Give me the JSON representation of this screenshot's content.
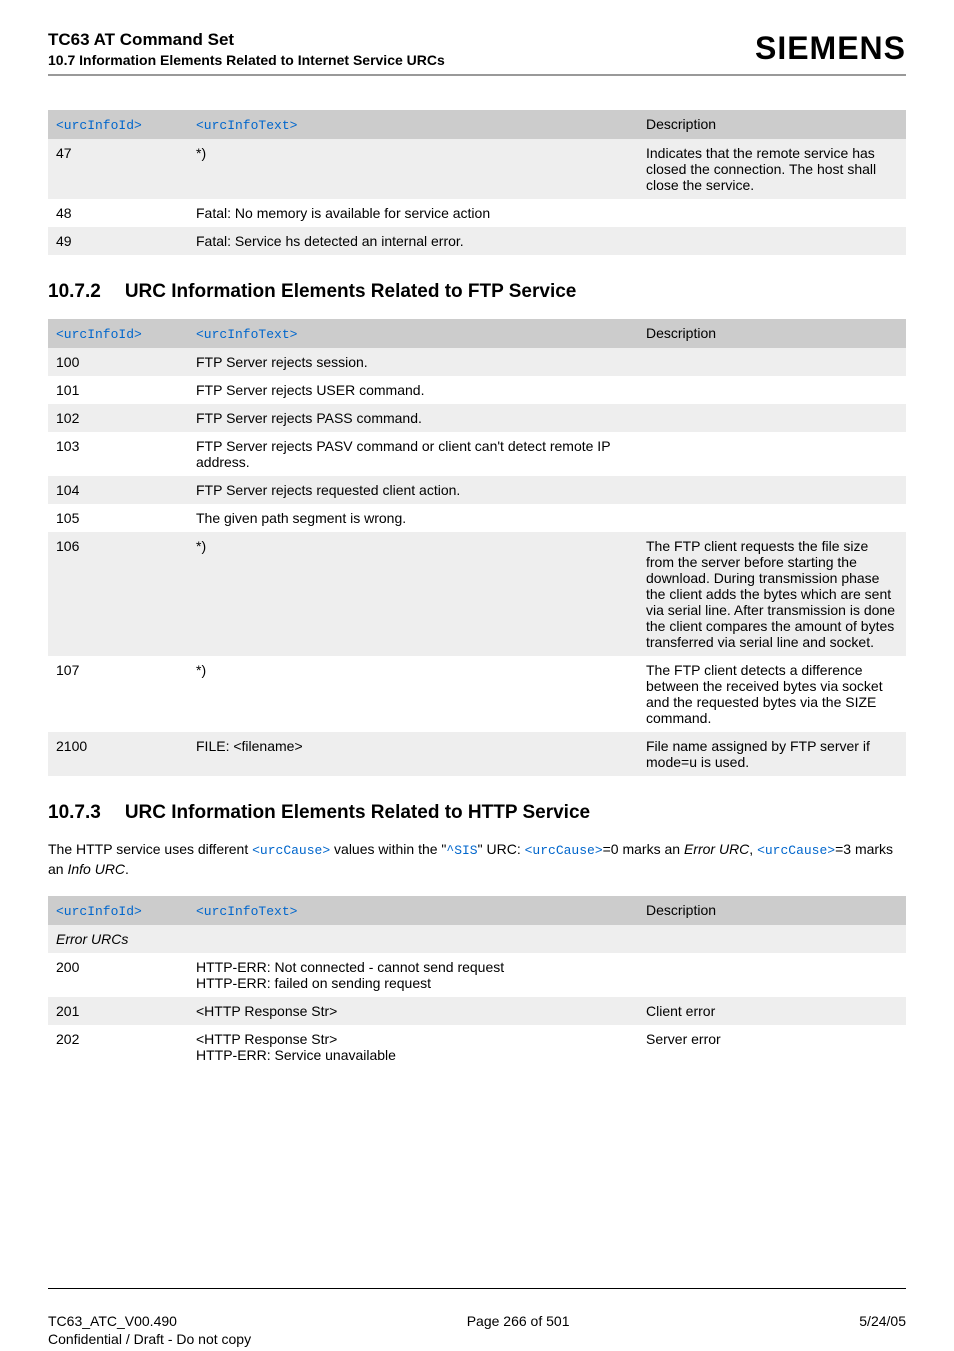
{
  "header": {
    "title": "TC63 AT Command Set",
    "subtitle": "10.7 Information Elements Related to Internet Service URCs",
    "logo": "SIEMENS"
  },
  "table1": {
    "headers": {
      "id": "<urcInfoId>",
      "text": "<urcInfoText>",
      "desc": "Description"
    },
    "rows": [
      {
        "id": "47",
        "text": "*)",
        "desc": "Indicates that the remote ser­vice has closed the connection. The host shall close the service."
      },
      {
        "id": "48",
        "text": "Fatal: No memory is available for service action",
        "desc": ""
      },
      {
        "id": "49",
        "text": "Fatal: Service hs detected an internal error.",
        "desc": ""
      }
    ]
  },
  "section2": {
    "num": "10.7.2",
    "title": "URC Information Elements Related to FTP Service"
  },
  "table2": {
    "headers": {
      "id": "<urcInfoId>",
      "text": "<urcInfoText>",
      "desc": "Description"
    },
    "rows": [
      {
        "id": "100",
        "text": "FTP Server rejects session.",
        "desc": ""
      },
      {
        "id": "101",
        "text": "FTP Server rejects USER command.",
        "desc": ""
      },
      {
        "id": "102",
        "text": "FTP Server rejects PASS command.",
        "desc": ""
      },
      {
        "id": "103",
        "text": "FTP Server rejects PASV command or client can't detect remote IP address.",
        "desc": ""
      },
      {
        "id": "104",
        "text": "FTP Server rejects requested client action.",
        "desc": ""
      },
      {
        "id": "105",
        "text": "The given path segment is wrong.",
        "desc": ""
      },
      {
        "id": "106",
        "text": "*)",
        "desc": "The FTP client requests the file size from the server before starting the download. During transmission phase the client adds the bytes which are sent via serial line. After transmis­sion is done the client com­pares the amount of bytes transferred via serial line and socket."
      },
      {
        "id": "107",
        "text": "*)",
        "desc": "The FTP client detects a differ­ence between the received bytes via socket and the requested bytes via the SIZE command."
      },
      {
        "id": "2100",
        "text": "FILE: <filename>",
        "desc": "File name assigned by FTP server if mode=u is used."
      }
    ]
  },
  "section3": {
    "num": "10.7.3",
    "title": "URC Information Elements Related to HTTP Service"
  },
  "para3": {
    "t1": "The HTTP service uses different ",
    "c1": "<urcCause>",
    "t2": " values within the \"",
    "c2": "^SIS",
    "t3": "\" URC: ",
    "c3": "<urcCause>",
    "t4": "=0 marks an ",
    "i1": "Error URC",
    "t5": ", ",
    "c4": "<urcCause>",
    "t6": "=3 marks an ",
    "i2": "Info URC",
    "t7": "."
  },
  "table3": {
    "headers": {
      "id": "<urcInfoId>",
      "text": "<urcInfoText>",
      "desc": "Description"
    },
    "groupLabel": "Error URCs",
    "rows": [
      {
        "id": "200",
        "text": "HTTP-ERR: Not connected - cannot send request\nHTTP-ERR: failed on sending request",
        "desc": ""
      },
      {
        "id": "201",
        "text": "<HTTP Response Str>",
        "desc": "Client error"
      },
      {
        "id": "202",
        "text": "<HTTP Response Str>\nHTTP-ERR: Service unavailable",
        "desc": "Server error"
      }
    ]
  },
  "footer": {
    "left": "TC63_ATC_V00.490",
    "center": "Page 266 of 501",
    "right": "5/24/05",
    "conf": "Confidential / Draft - Do not copy"
  }
}
